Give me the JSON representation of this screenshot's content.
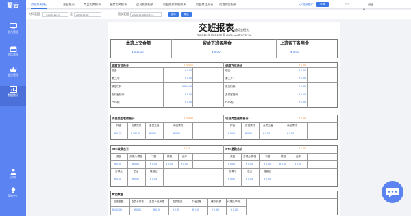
{
  "app": {
    "logo": "蜀云"
  },
  "sidebar": {
    "items": [
      {
        "label": "前台管理",
        "icon": "monitor-icon"
      },
      {
        "label": "酒店管理",
        "icon": "store-icon"
      },
      {
        "label": "会员管理",
        "icon": "crown-icon"
      },
      {
        "label": "数据统计",
        "icon": "chart-book-icon"
      },
      {
        "label": "分销",
        "icon": "user-icon"
      },
      {
        "label": "帮助中心",
        "icon": "bulb-icon"
      }
    ]
  },
  "tabs": [
    "交班报表(新)",
    "营业报表",
    "商品相关报表",
    "客房相关报表",
    "会员相关报表",
    "前台收款明细报表",
    "前台商品报表",
    "渠道佣金报表"
  ],
  "topbar": {
    "mini_program": "小程序推广",
    "action_btn": "店铺",
    "user": "****",
    "user_icon": "user-icon",
    "logout": "退出"
  },
  "filter": {
    "date_label": "时间范围:",
    "date_start": "2020-12-27",
    "date_sep": "至",
    "date_end": "2020-12-28",
    "shift_label": "班次范围:",
    "shift_value": "2020-12-28 02:51:3",
    "search_btn": "查询",
    "export_btn": "导出"
  },
  "report": {
    "title": "交班报表",
    "title_mode": "(备用金模式)",
    "subtitle": "2020-12-28 02:01:36 至 2020-12-28 07:57:12",
    "summary": [
      {
        "label": "本班上交金额",
        "value": "¥ 204.00"
      },
      {
        "label": "留给下班备用金",
        "value": "¥ 0.00"
      },
      {
        "label": "上班留下备用金",
        "value": "¥ 0.00"
      }
    ],
    "collect": {
      "title": "收款方式合计",
      "total": "¥ 204.00",
      "rows": [
        {
          "label": "现金:",
          "value": "¥ 0.00"
        },
        {
          "label": "第三方:",
          "value": "¥ 0.00"
        },
        {
          "label": "微信扫码:",
          "value": "¥ 204.00"
        },
        {
          "label": "支付宝扫码:",
          "value": "¥ 0.00"
        },
        {
          "label": "POS机:",
          "value": "¥ 0.00"
        }
      ]
    },
    "refund": {
      "title": "退款方式合计",
      "total": "¥ 0.00",
      "rows": [
        {
          "label": "现金:",
          "value": "¥ 0.00"
        },
        {
          "label": "第三方:",
          "value": "¥ 0.00"
        },
        {
          "label": "微信扫码:",
          "value": "¥ 0.00"
        },
        {
          "label": "支付宝扫码:",
          "value": "¥ 0.00"
        },
        {
          "label": "POS机:",
          "value": "¥ 0.00"
        }
      ]
    },
    "item_collect": {
      "title": "项目类型收款合计",
      "total": "¥ 204.00",
      "headers": [
        "押金",
        "房费预付",
        "会员充值",
        "商品预付"
      ],
      "values": [
        "¥ 0.00",
        "¥ 194.00",
        "¥ 0.00",
        "¥ 0.00"
      ]
    },
    "item_refund": {
      "title": "项目类型退款合计",
      "total": "¥ 0.00",
      "headers": [
        "押金",
        "房费预付",
        "会员充值",
        "商品预付"
      ],
      "values": [
        "¥ 0.00",
        "¥ 0.00",
        "¥ 0.00",
        "¥ 0.00"
      ]
    },
    "ota_collect": {
      "title": "OTA收款合计",
      "total": "¥ 0.00",
      "headers": [
        "美团",
        "去哪儿/携程",
        "飞猪",
        "携程",
        "途牛"
      ],
      "values": [
        "¥ 0.00",
        "¥ 0.00",
        "¥ 0.00",
        "¥ 0.00",
        "¥ 0.00"
      ],
      "headers2": [
        "去哪儿",
        "艺龙",
        "极客云"
      ],
      "values2": [
        "¥ 0.00",
        "¥ 0.00",
        "¥ 0.00"
      ]
    },
    "ota_refund": {
      "title": "OTA退款合计",
      "total": "¥ 0.00",
      "headers": [
        "美团",
        "去哪儿/携程",
        "飞猪",
        "携程",
        "途牛"
      ],
      "values": [
        "¥ 0.00",
        "¥ 0.00",
        "¥ 0.00",
        "¥ 0.00",
        "¥ 0.00"
      ],
      "headers2": [
        "去哪儿",
        "艺龙",
        "极客云"
      ],
      "values2": [
        "¥ 0.00",
        "¥ 0.00",
        "¥ 0.00"
      ]
    },
    "other": {
      "title": "其它数据",
      "headers": [
        "应收金额",
        "会员卡扣款",
        "会员卡已消费",
        "会员赠送",
        "中途挂账",
        "储存余额",
        "代理挂单剩"
      ],
      "values": [
        "¥ 151.00",
        "¥ 0.00",
        "¥ 0.00",
        "¥ 0.00",
        "¥ 0.00",
        "¥ 0.00",
        "¥ 0.00"
      ]
    }
  }
}
